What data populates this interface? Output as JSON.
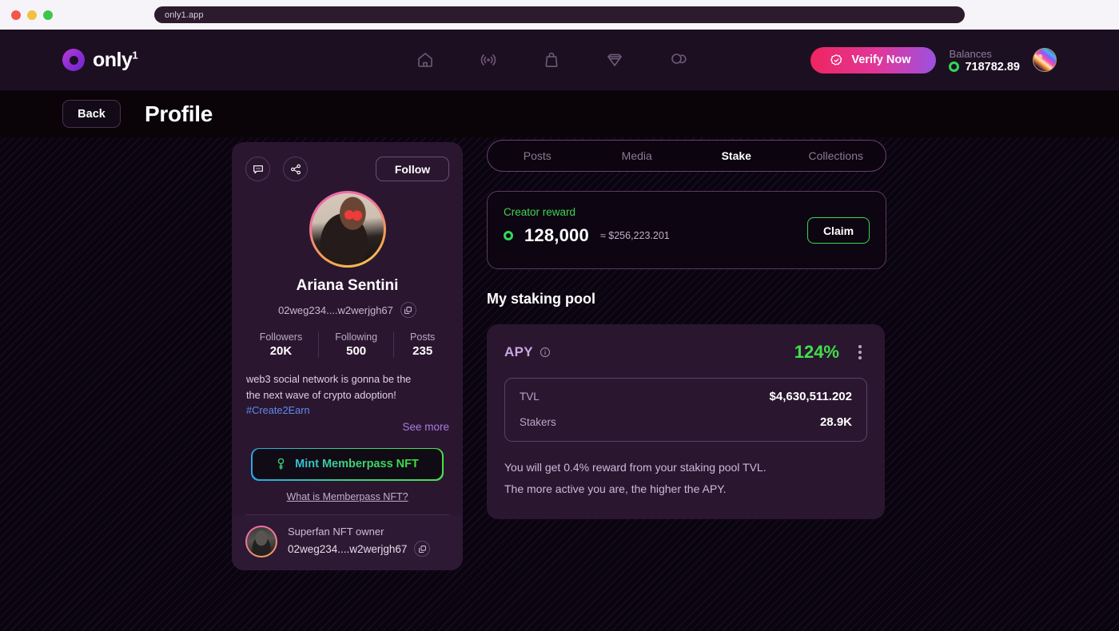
{
  "browser": {
    "url": "only1.app",
    "traffic_lights": [
      "close",
      "minimize",
      "maximize"
    ]
  },
  "header": {
    "logo_text": "only",
    "logo_sup": "1",
    "nav_icons": [
      "home-icon",
      "live-icon",
      "shop-bag-icon",
      "gem-icon",
      "chat-icon"
    ],
    "verify_label": "Verify Now",
    "balances_label": "Balances",
    "balances_value": "718782.89"
  },
  "subheader": {
    "back_label": "Back",
    "title": "Profile"
  },
  "profile": {
    "follow_label": "Follow",
    "name": "Ariana Sentini",
    "wallet": "02weg234....w2werjgh67",
    "stats": [
      {
        "label": "Followers",
        "value": "20K"
      },
      {
        "label": "Following",
        "value": "500"
      },
      {
        "label": "Posts",
        "value": "235"
      }
    ],
    "bio_line1": "web3 social network is gonna be the",
    "bio_line2": "the next wave of crypto adoption!",
    "bio_tag": "#Create2Earn",
    "see_more": "See more",
    "mint_label": "Mint Memberpass NFT",
    "what_is_link": "What is Memberpass NFT?",
    "superfan_title": "Superfan NFT owner",
    "superfan_wallet": "02weg234....w2werjgh67"
  },
  "tabs": [
    {
      "label": "Posts",
      "active": false
    },
    {
      "label": "Media",
      "active": false
    },
    {
      "label": "Stake",
      "active": true
    },
    {
      "label": "Collections",
      "active": false
    }
  ],
  "reward": {
    "label": "Creator reward",
    "amount": "128,000",
    "usd": "≈ $256,223.201",
    "claim_label": "Claim"
  },
  "staking": {
    "section_title": "My staking pool",
    "apy_label": "APY",
    "apy_value": "124%",
    "rows": [
      {
        "label": "TVL",
        "value": "$4,630,511.202"
      },
      {
        "label": "Stakers",
        "value": "28.9K"
      }
    ],
    "note_line1": "You will get 0.4% reward from your staking pool TVL.",
    "note_line2": "The more active you are, the higher the APY."
  },
  "colors": {
    "accent_green": "#3FD44F",
    "accent_purple": "#A87EE0",
    "card_bg": "#2B1630",
    "page_bg": "#0A0410",
    "verify_gradient_start": "#EF2560",
    "verify_gradient_end": "#9B52E0"
  }
}
